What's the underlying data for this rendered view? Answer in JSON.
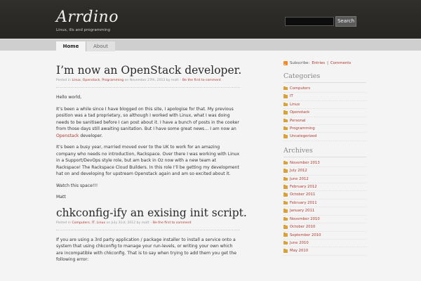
{
  "header": {
    "site_title": "Arrdino",
    "site_description": "Linux, ills and programming",
    "search_placeholder": "",
    "search_button": "Search"
  },
  "nav": {
    "tabs": [
      {
        "label": "Home",
        "active": true
      },
      {
        "label": "About",
        "active": false
      }
    ]
  },
  "posts": [
    {
      "title": "I’m now an OpenStack developer.",
      "meta_prefix": "Posted in",
      "categories": [
        "Linux",
        "Openstack",
        "Programming"
      ],
      "date_text": "on November 27th, 2013 by matt –",
      "comments_link": "Be the first to comment",
      "paragraphs": [
        "Hello world,",
        "It’s been a while since I have blogged on this site, I apologise for that. My previous position was a tad proprietary, so although I worked with Linux, what I was doing needs to be sanitised before I can post about it. I have a bunch of posts in the cooker from those days still awaiting sanitation. But I have some great news… I am now an",
        "It’s been a busy year, married moved over to the UK to work for an amazing company who needs no introduction, Rackspace. Over there I was working with Linux in a Support/DevOps style role, but am back in Oz now with a new team at Rackspace! The Rackspace Cloud Builders. In this role I’ll be getting my development hat on and developing for upstream Openstack again and am so excited about it.",
        "Watch this space!!!",
        "Matt"
      ],
      "inline_link": "Openstack",
      "inline_after": "developer."
    },
    {
      "title": "chkconfig-ify an exising init script.",
      "meta_prefix": "Posted in",
      "categories": [
        "Computers",
        "IT",
        "Linux"
      ],
      "date_text": "on July 31st, 2012 by matt –",
      "comments_link": "Be the first to comment",
      "paragraphs": [
        "If you are using a 3rd party application / package installer to install a service onto a system that using chkconfig to manage your run-levels, or writing your own which are incompatible with chkconfig. That is to say when trying to add them you get the following error:"
      ]
    }
  ],
  "sidebar": {
    "subscribe_label": "Subscribe:",
    "entries_link": "Entries",
    "separator": "|",
    "comments_link": "Comments",
    "categories_title": "Categories",
    "categories": [
      "Computers",
      "IT",
      "Linux",
      "Openstack",
      "Personal",
      "Programming",
      "Uncategorized"
    ],
    "archives_title": "Archives",
    "archives": [
      "November 2013",
      "July 2012",
      "June 2012",
      "February 2012",
      "October 2011",
      "February 2011",
      "January 2011",
      "November 2010",
      "October 2010",
      "September 2010",
      "June 2010",
      "May 2010"
    ]
  }
}
